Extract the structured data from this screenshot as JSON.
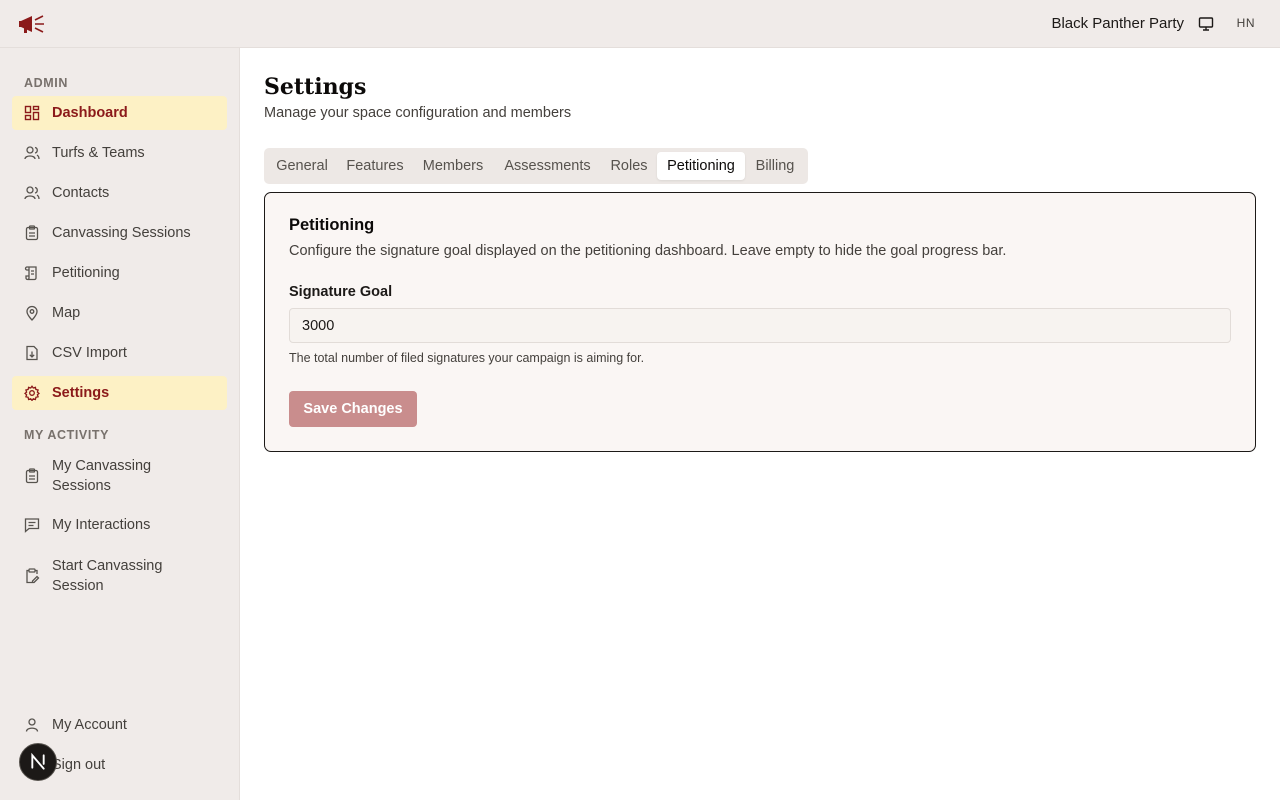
{
  "header": {
    "org_name": "Black Panther Party",
    "user_initials": "HN",
    "brand_color": "#8b1a1a"
  },
  "sidebar": {
    "admin_label": "ADMIN",
    "admin_items": [
      {
        "label": "Dashboard",
        "icon": "dashboard-icon",
        "active": true
      },
      {
        "label": "Turfs & Teams",
        "icon": "users-icon",
        "active": false
      },
      {
        "label": "Contacts",
        "icon": "contacts-icon",
        "active": false
      },
      {
        "label": "Canvassing Sessions",
        "icon": "clipboard-icon",
        "active": false
      },
      {
        "label": "Petitioning",
        "icon": "scroll-icon",
        "active": false
      },
      {
        "label": "Map",
        "icon": "map-pin-icon",
        "active": false
      },
      {
        "label": "CSV Import",
        "icon": "file-import-icon",
        "active": false
      },
      {
        "label": "Settings",
        "icon": "gear-icon",
        "active": true
      }
    ],
    "activity_label": "MY ACTIVITY",
    "activity_items": [
      {
        "label": "My Canvassing Sessions",
        "icon": "clipboard-icon"
      },
      {
        "label": "My Interactions",
        "icon": "message-icon"
      },
      {
        "label": "Start Canvassing Session",
        "icon": "clipboard-pen-icon"
      }
    ],
    "footer_items": [
      {
        "label": "My Account",
        "icon": "user-icon"
      },
      {
        "label": "Sign out",
        "icon": "logout-icon"
      }
    ]
  },
  "page": {
    "title": "Settings",
    "subtitle": "Manage your space configuration and members"
  },
  "tabs": [
    {
      "label": "General",
      "active": false
    },
    {
      "label": "Features",
      "active": false
    },
    {
      "label": "Members",
      "active": false
    },
    {
      "label": "Assessments",
      "active": false
    },
    {
      "label": "Roles",
      "active": false
    },
    {
      "label": "Petitioning",
      "active": true
    },
    {
      "label": "Billing",
      "active": false
    }
  ],
  "card": {
    "title": "Petitioning",
    "description": "Configure the signature goal displayed on the petitioning dashboard. Leave empty to hide the goal progress bar.",
    "field_label": "Signature Goal",
    "field_value": "3000",
    "field_help": "The total number of filed signatures your campaign is aiming for.",
    "save_label": "Save Changes"
  }
}
